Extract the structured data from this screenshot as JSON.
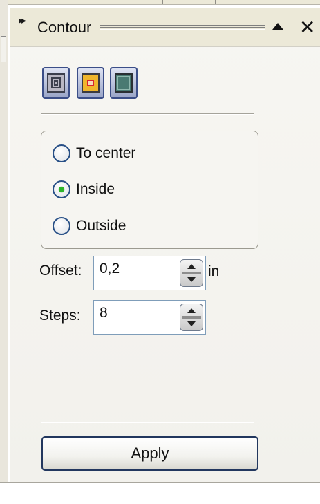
{
  "panel": {
    "title": "Contour",
    "title_arrows": "▸▸"
  },
  "mode_buttons": [
    {
      "name": "to-center-mode",
      "icon": "concentric-squares-icon"
    },
    {
      "name": "inside-mode",
      "icon": "inside-contour-icon"
    },
    {
      "name": "outside-mode",
      "icon": "outside-contour-icon"
    }
  ],
  "direction": {
    "options": [
      {
        "label": "To center",
        "selected": false
      },
      {
        "label": "Inside",
        "selected": true
      },
      {
        "label": "Outside",
        "selected": false
      }
    ]
  },
  "offset": {
    "label": "Offset:",
    "value": "0,2",
    "unit": "in"
  },
  "steps": {
    "label": "Steps:",
    "value": "8"
  },
  "apply_label": "Apply",
  "colors": {
    "accent": "#3b4e88",
    "radio_selected": "#2db52a",
    "field_border": "#7f9db9"
  }
}
